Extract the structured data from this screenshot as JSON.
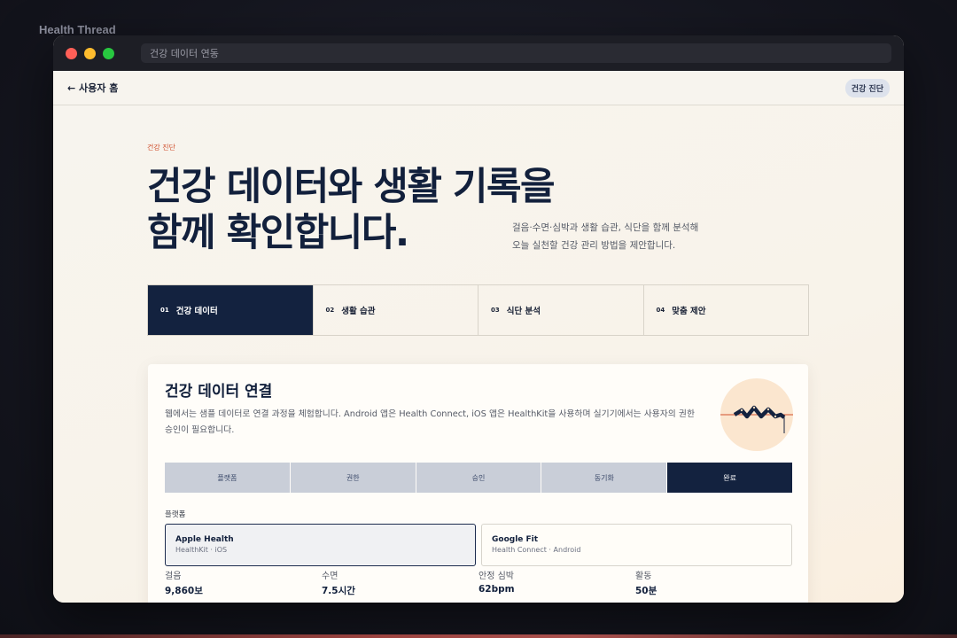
{
  "app_label": "Health Thread",
  "window": {
    "address": "건강 데이터 연동"
  },
  "topnav": {
    "back_label": "← 사용자 홈",
    "badge": "건강 진단"
  },
  "hero": {
    "eyebrow": "건강 진단",
    "headline_line1": "건강 데이터와 생활 기록을",
    "headline_line2": "함께 확인합니다.",
    "intro_line1": "걸음·수면·심박과 생활 습관, 식단을 함께 분석해",
    "intro_line2": "오늘 실천할 건강 관리 방법을 제안합니다."
  },
  "steps": [
    {
      "num": "01",
      "label": "건강 데이터",
      "active": true
    },
    {
      "num": "02",
      "label": "생활 습관",
      "active": false
    },
    {
      "num": "03",
      "label": "식단 분석",
      "active": false
    },
    {
      "num": "04",
      "label": "맞춤 제안",
      "active": false
    }
  ],
  "card": {
    "title": "건강 데이터 연결",
    "description": "웹에서는 샘플 데이터로 연결 과정을 체험합니다. Android 앱은 Health Connect, iOS 앱은 HealthKit을 사용하며 실기기에서는 사용자의 권한 승인이 필요합니다.",
    "tabs": [
      {
        "label": "플랫폼",
        "active": false
      },
      {
        "label": "권한",
        "active": false
      },
      {
        "label": "승인",
        "active": false
      },
      {
        "label": "동기화",
        "active": false
      },
      {
        "label": "완료",
        "active": true
      }
    ],
    "platform_label": "플랫폼",
    "platforms": [
      {
        "name": "Apple Health",
        "sub": "HealthKit · iOS",
        "selected": true
      },
      {
        "name": "Google Fit",
        "sub": "Health Connect · Android",
        "selected": false
      }
    ],
    "metrics": [
      {
        "label": "걸음",
        "value": "9,860보"
      },
      {
        "label": "수면",
        "value": "7.5시간"
      },
      {
        "label": "안정 심박",
        "value": "62bpm"
      },
      {
        "label": "활동",
        "value": "50분"
      }
    ]
  },
  "colors": {
    "navy": "#13223f",
    "accent": "#d0502e",
    "illustration_bg": "#fbe6cf"
  },
  "icons": {
    "back": "arrow-left-icon",
    "illustration": "heart-rate-line-icon"
  }
}
